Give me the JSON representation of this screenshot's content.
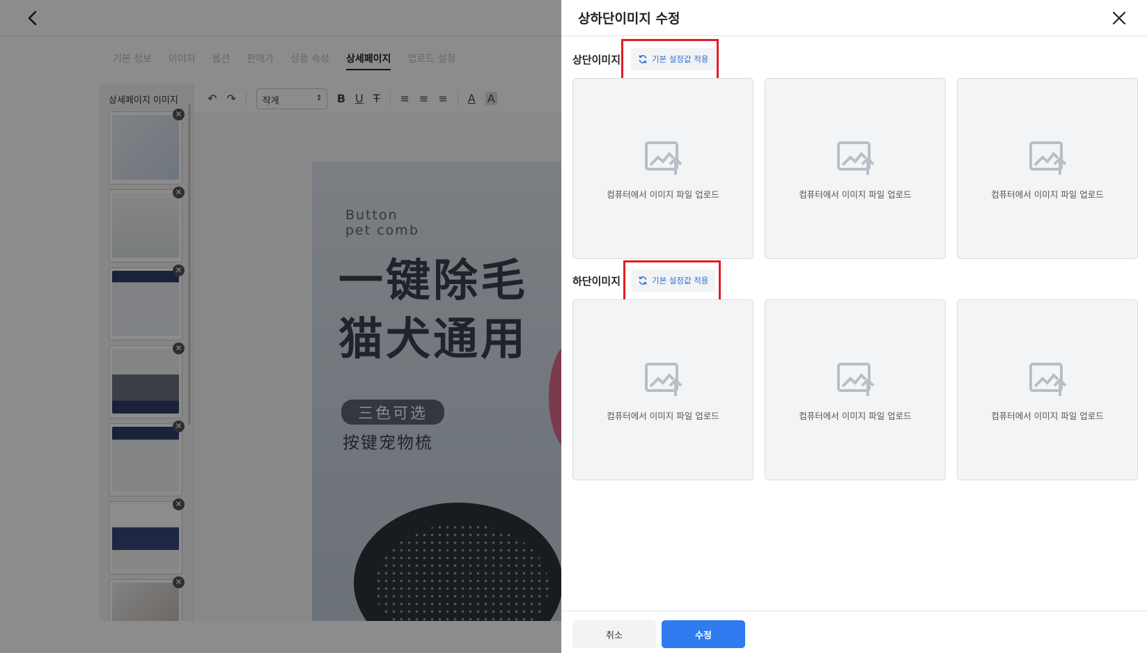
{
  "background_page": {
    "tabs": [
      {
        "label": "기본 정보",
        "active": false
      },
      {
        "label": "이미지",
        "active": false
      },
      {
        "label": "옵션",
        "active": false
      },
      {
        "label": "판매가",
        "active": false
      },
      {
        "label": "상품 속성",
        "active": false
      },
      {
        "label": "상세페이지",
        "active": true
      },
      {
        "label": "업로드 설정",
        "active": false
      }
    ],
    "thumbnail_panel_title": "상세페이지 이미지",
    "toolbar": {
      "font_size_value": "작게"
    },
    "product_image": {
      "subtitle_line1": "Button",
      "subtitle_line2": "pet comb",
      "headline_line1": "一键除毛",
      "headline_line2": "猫犬通用",
      "pill_text": "三色可选",
      "subline": "按键宠物梳"
    }
  },
  "drawer": {
    "title": "상하단이미지 수정",
    "top_section": {
      "label": "상단이미지",
      "reset_button": "기본 설정값 적용",
      "upload_slots": [
        {
          "text": "컴퓨터에서 이미지 파일 업로드"
        },
        {
          "text": "컴퓨터에서 이미지 파일 업로드"
        },
        {
          "text": "컴퓨터에서 이미지 파일 업로드"
        }
      ]
    },
    "bottom_section": {
      "label": "하단이미지",
      "reset_button": "기본 설정값 적용",
      "upload_slots": [
        {
          "text": "컴퓨터에서 이미지 파일 업로드"
        },
        {
          "text": "컴퓨터에서 이미지 파일 업로드"
        },
        {
          "text": "컴퓨터에서 이미지 파일 업로드"
        }
      ]
    },
    "footer": {
      "cancel_label": "취소",
      "submit_label": "수정"
    }
  },
  "colors": {
    "accent_blue": "#2f7bf0",
    "highlight_red": "#e11c24",
    "upload_bg": "#f2f4f6"
  },
  "icons": [
    "back-arrow-icon",
    "close-icon",
    "refresh-icon",
    "image-upload-icon",
    "undo-icon",
    "redo-icon",
    "bold-icon",
    "underline-icon",
    "strikethrough-icon",
    "align-left-icon",
    "align-center-icon",
    "align-right-icon",
    "font-color-icon",
    "highlight-icon",
    "remove-thumbnail-icon"
  ]
}
